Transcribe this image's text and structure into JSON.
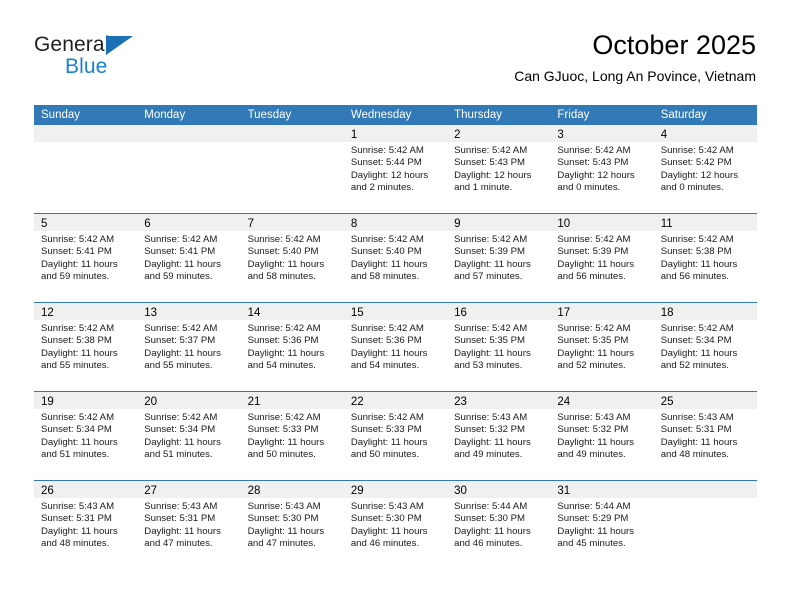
{
  "brand": {
    "name_top": "General",
    "name_bottom": "Blue",
    "accent_color": "#1b7fd4",
    "triangle_color": "#1b6fb5"
  },
  "header": {
    "title": "October 2025",
    "subtitle": "Can GJuoc, Long An Povince, Vietnam"
  },
  "theme": {
    "header_blue": "#3279b7",
    "day_band_gray": "#f0f0f0",
    "text_color": "#000000"
  },
  "calendar": {
    "weekdays": [
      "Sunday",
      "Monday",
      "Tuesday",
      "Wednesday",
      "Thursday",
      "Friday",
      "Saturday"
    ],
    "weeks": [
      [
        {
          "day": "",
          "lines": []
        },
        {
          "day": "",
          "lines": []
        },
        {
          "day": "",
          "lines": []
        },
        {
          "day": "1",
          "lines": [
            "Sunrise: 5:42 AM",
            "Sunset: 5:44 PM",
            "Daylight: 12 hours",
            "and 2 minutes."
          ]
        },
        {
          "day": "2",
          "lines": [
            "Sunrise: 5:42 AM",
            "Sunset: 5:43 PM",
            "Daylight: 12 hours",
            "and 1 minute."
          ]
        },
        {
          "day": "3",
          "lines": [
            "Sunrise: 5:42 AM",
            "Sunset: 5:43 PM",
            "Daylight: 12 hours",
            "and 0 minutes."
          ]
        },
        {
          "day": "4",
          "lines": [
            "Sunrise: 5:42 AM",
            "Sunset: 5:42 PM",
            "Daylight: 12 hours",
            "and 0 minutes."
          ]
        }
      ],
      [
        {
          "day": "5",
          "lines": [
            "Sunrise: 5:42 AM",
            "Sunset: 5:41 PM",
            "Daylight: 11 hours",
            "and 59 minutes."
          ]
        },
        {
          "day": "6",
          "lines": [
            "Sunrise: 5:42 AM",
            "Sunset: 5:41 PM",
            "Daylight: 11 hours",
            "and 59 minutes."
          ]
        },
        {
          "day": "7",
          "lines": [
            "Sunrise: 5:42 AM",
            "Sunset: 5:40 PM",
            "Daylight: 11 hours",
            "and 58 minutes."
          ]
        },
        {
          "day": "8",
          "lines": [
            "Sunrise: 5:42 AM",
            "Sunset: 5:40 PM",
            "Daylight: 11 hours",
            "and 58 minutes."
          ]
        },
        {
          "day": "9",
          "lines": [
            "Sunrise: 5:42 AM",
            "Sunset: 5:39 PM",
            "Daylight: 11 hours",
            "and 57 minutes."
          ]
        },
        {
          "day": "10",
          "lines": [
            "Sunrise: 5:42 AM",
            "Sunset: 5:39 PM",
            "Daylight: 11 hours",
            "and 56 minutes."
          ]
        },
        {
          "day": "11",
          "lines": [
            "Sunrise: 5:42 AM",
            "Sunset: 5:38 PM",
            "Daylight: 11 hours",
            "and 56 minutes."
          ]
        }
      ],
      [
        {
          "day": "12",
          "lines": [
            "Sunrise: 5:42 AM",
            "Sunset: 5:38 PM",
            "Daylight: 11 hours",
            "and 55 minutes."
          ]
        },
        {
          "day": "13",
          "lines": [
            "Sunrise: 5:42 AM",
            "Sunset: 5:37 PM",
            "Daylight: 11 hours",
            "and 55 minutes."
          ]
        },
        {
          "day": "14",
          "lines": [
            "Sunrise: 5:42 AM",
            "Sunset: 5:36 PM",
            "Daylight: 11 hours",
            "and 54 minutes."
          ]
        },
        {
          "day": "15",
          "lines": [
            "Sunrise: 5:42 AM",
            "Sunset: 5:36 PM",
            "Daylight: 11 hours",
            "and 54 minutes."
          ]
        },
        {
          "day": "16",
          "lines": [
            "Sunrise: 5:42 AM",
            "Sunset: 5:35 PM",
            "Daylight: 11 hours",
            "and 53 minutes."
          ]
        },
        {
          "day": "17",
          "lines": [
            "Sunrise: 5:42 AM",
            "Sunset: 5:35 PM",
            "Daylight: 11 hours",
            "and 52 minutes."
          ]
        },
        {
          "day": "18",
          "lines": [
            "Sunrise: 5:42 AM",
            "Sunset: 5:34 PM",
            "Daylight: 11 hours",
            "and 52 minutes."
          ]
        }
      ],
      [
        {
          "day": "19",
          "lines": [
            "Sunrise: 5:42 AM",
            "Sunset: 5:34 PM",
            "Daylight: 11 hours",
            "and 51 minutes."
          ]
        },
        {
          "day": "20",
          "lines": [
            "Sunrise: 5:42 AM",
            "Sunset: 5:34 PM",
            "Daylight: 11 hours",
            "and 51 minutes."
          ]
        },
        {
          "day": "21",
          "lines": [
            "Sunrise: 5:42 AM",
            "Sunset: 5:33 PM",
            "Daylight: 11 hours",
            "and 50 minutes."
          ]
        },
        {
          "day": "22",
          "lines": [
            "Sunrise: 5:42 AM",
            "Sunset: 5:33 PM",
            "Daylight: 11 hours",
            "and 50 minutes."
          ]
        },
        {
          "day": "23",
          "lines": [
            "Sunrise: 5:43 AM",
            "Sunset: 5:32 PM",
            "Daylight: 11 hours",
            "and 49 minutes."
          ]
        },
        {
          "day": "24",
          "lines": [
            "Sunrise: 5:43 AM",
            "Sunset: 5:32 PM",
            "Daylight: 11 hours",
            "and 49 minutes."
          ]
        },
        {
          "day": "25",
          "lines": [
            "Sunrise: 5:43 AM",
            "Sunset: 5:31 PM",
            "Daylight: 11 hours",
            "and 48 minutes."
          ]
        }
      ],
      [
        {
          "day": "26",
          "lines": [
            "Sunrise: 5:43 AM",
            "Sunset: 5:31 PM",
            "Daylight: 11 hours",
            "and 48 minutes."
          ]
        },
        {
          "day": "27",
          "lines": [
            "Sunrise: 5:43 AM",
            "Sunset: 5:31 PM",
            "Daylight: 11 hours",
            "and 47 minutes."
          ]
        },
        {
          "day": "28",
          "lines": [
            "Sunrise: 5:43 AM",
            "Sunset: 5:30 PM",
            "Daylight: 11 hours",
            "and 47 minutes."
          ]
        },
        {
          "day": "29",
          "lines": [
            "Sunrise: 5:43 AM",
            "Sunset: 5:30 PM",
            "Daylight: 11 hours",
            "and 46 minutes."
          ]
        },
        {
          "day": "30",
          "lines": [
            "Sunrise: 5:44 AM",
            "Sunset: 5:30 PM",
            "Daylight: 11 hours",
            "and 46 minutes."
          ]
        },
        {
          "day": "31",
          "lines": [
            "Sunrise: 5:44 AM",
            "Sunset: 5:29 PM",
            "Daylight: 11 hours",
            "and 45 minutes."
          ]
        },
        {
          "day": "",
          "lines": []
        }
      ]
    ]
  }
}
